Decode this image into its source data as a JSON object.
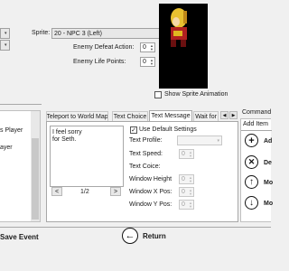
{
  "sprite": {
    "label": "Sprite:",
    "value": "20 - NPC 3 (Left)",
    "show_animation_label": "Show Sprite Animation"
  },
  "enemy": {
    "defeat_action_label": "Enemy Defeat Action:",
    "defeat_action_value": "0",
    "life_points_label": "Enemy Life Points:",
    "life_points_value": "0"
  },
  "left_list": {
    "items": [
      "s Player",
      "ayer"
    ]
  },
  "tabs": {
    "items": [
      "Teleport to World Map",
      "Text Choice",
      "Text Message",
      "Wait for"
    ],
    "active": "Text Message"
  },
  "message": {
    "text_line1": "I feel sorry",
    "text_line2": "for Seth.",
    "prev_label": "<",
    "next_label": ">",
    "page_indicator": "1/2"
  },
  "settings": {
    "use_default_label": "Use Default Settings",
    "use_default_checked": "✓",
    "text_profile_label": "Text Profile:",
    "text_speed_label": "Text Speed:",
    "text_speed_value": "0",
    "text_coice_label": "Text Coice:",
    "window_height_label": "Window Height",
    "window_height_value": "0",
    "window_x_label": "Window X Pos:",
    "window_x_value": "0",
    "window_y_label": "Window Y Pos:",
    "window_y_value": "0"
  },
  "commands": {
    "header": "Command",
    "add_item_label": "Add Item",
    "buttons": [
      {
        "icon": "plus-icon",
        "label": "Ad"
      },
      {
        "icon": "delete-icon",
        "label": "De"
      },
      {
        "icon": "arrow-up-icon",
        "label": "Mo"
      },
      {
        "icon": "arrow-down-icon",
        "label": "Mo"
      }
    ]
  },
  "footer": {
    "save_label": "Save Event",
    "return_label": "Return"
  }
}
